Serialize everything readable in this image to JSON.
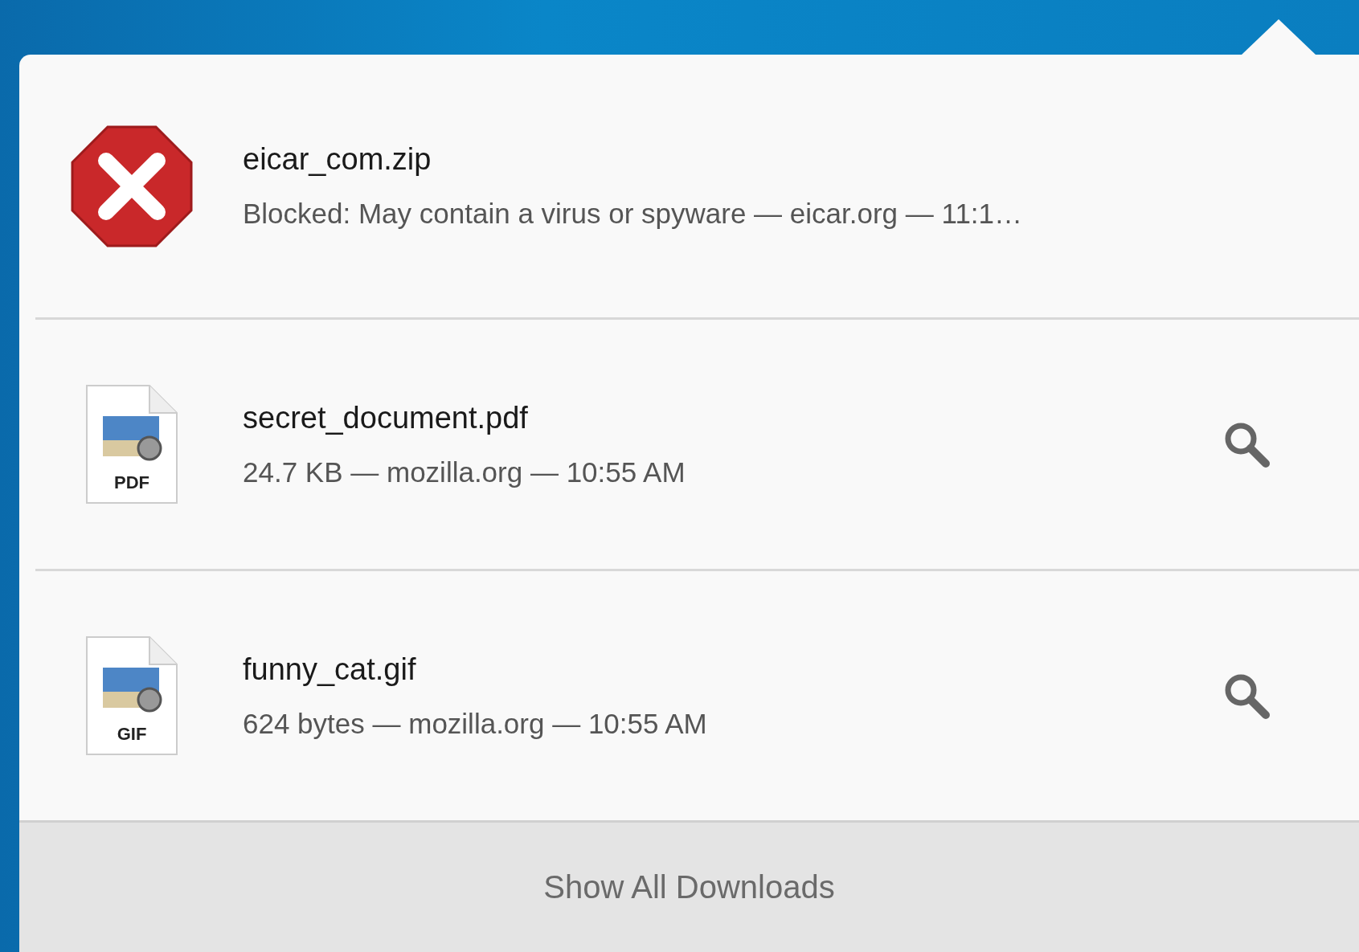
{
  "downloads": [
    {
      "kind": "blocked",
      "name": "eicar_com.zip",
      "details": "Blocked: May contain a virus or spyware — eicar.org — 11:1…"
    },
    {
      "kind": "file",
      "file_type": "PDF",
      "name": "secret_document.pdf",
      "details": "24.7 KB — mozilla.org — 10:55 AM"
    },
    {
      "kind": "file",
      "file_type": "GIF",
      "name": "funny_cat.gif",
      "details": "624 bytes — mozilla.org — 10:55 AM"
    }
  ],
  "footer": {
    "label": "Show All Downloads"
  }
}
